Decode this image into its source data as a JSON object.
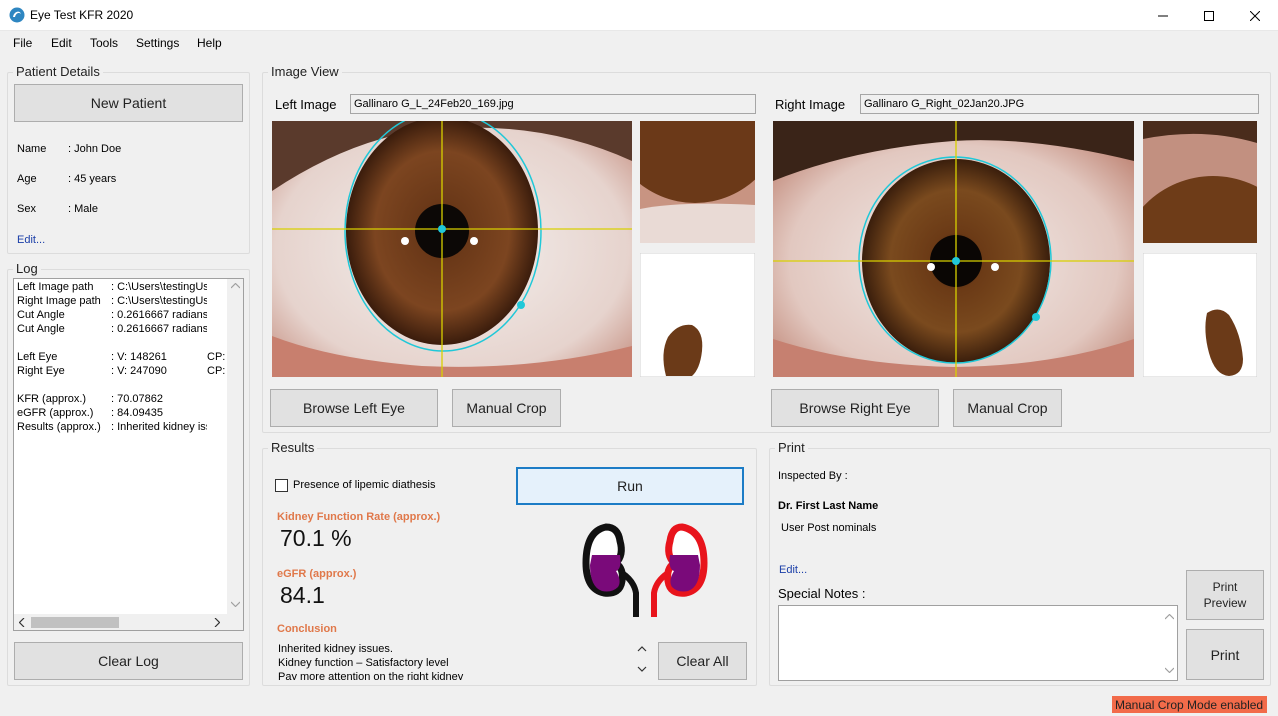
{
  "window": {
    "title": "Eye Test KFR 2020"
  },
  "menu": [
    "File",
    "Edit",
    "Tools",
    "Settings",
    "Help"
  ],
  "patient": {
    "group_label": "Patient Details",
    "new_patient_label": "New Patient",
    "fields": [
      {
        "key": "Name",
        "value": ": John Doe"
      },
      {
        "key": "Age",
        "value": ": 45 years"
      },
      {
        "key": "Sex",
        "value": ": Male"
      }
    ],
    "edit_link": "Edit..."
  },
  "log": {
    "group_label": "Log",
    "rows": [
      {
        "k": "Left Image path",
        "v": ": C:\\Users\\testingUser\\",
        "x": ""
      },
      {
        "k": "Right Image path",
        "v": ": C:\\Users\\testingUser\\",
        "x": ""
      },
      {
        "k": "Cut Angle",
        "v": ": 0.2616667 radians",
        "x": ""
      },
      {
        "k": "Cut Angle",
        "v": ": 0.2616667 radians",
        "x": ""
      },
      {
        "k": "",
        "v": "",
        "x": ""
      },
      {
        "k": "Left Eye",
        "v": ": V: 148261",
        "x": "CP:"
      },
      {
        "k": "Right Eye",
        "v": ": V: 247090",
        "x": "CP:"
      },
      {
        "k": "",
        "v": "",
        "x": ""
      },
      {
        "k": "KFR (approx.)",
        "v": ": 70.07862",
        "x": ""
      },
      {
        "k": "eGFR (approx.)",
        "v": ": 84.09435",
        "x": ""
      },
      {
        "k": "Results (approx.)",
        "v": ": Inherited kidney issu",
        "x": ""
      }
    ],
    "clear_label": "Clear Log"
  },
  "image_view": {
    "group_label": "Image View",
    "left": {
      "label": "Left Image",
      "filename": "Gallinaro G_L_24Feb20_169.jpg",
      "browse_label": "Browse Left Eye",
      "crop_label": "Manual Crop"
    },
    "right": {
      "label": "Right Image",
      "filename": "Gallinaro G_Right_02Jan20.JPG",
      "browse_label": "Browse Right Eye",
      "crop_label": "Manual Crop"
    }
  },
  "results": {
    "group_label": "Results",
    "lipemic_label": "Presence of lipemic diathesis",
    "lipemic_checked": false,
    "run_label": "Run",
    "kfr_label": "Kidney Function Rate (approx.)",
    "kfr_value": "70.1 %",
    "egfr_label": "eGFR (approx.)",
    "egfr_value": "84.1",
    "conclusion_label": "Conclusion",
    "conclusion_lines": [
      "Inherited kidney issues.",
      "Kidney function – Satisfactory level",
      "Pay more attention on the right kidney"
    ],
    "clear_all_label": "Clear All",
    "kidney_colors": {
      "left_outline": "#111111",
      "right_outline": "#e8141c",
      "fill": "#7a0a7a"
    }
  },
  "print": {
    "group_label": "Print",
    "inspected_label": "Inspected By :",
    "doctor_name": "Dr. First Last Name",
    "post_nominals": "User Post nominals",
    "edit_link": "Edit...",
    "notes_label": "Special Notes :",
    "notes_value": "",
    "preview_line1": "Print",
    "preview_line2": "Preview",
    "print_label": "Print"
  },
  "status": {
    "badge": "Manual Crop Mode enabled",
    "color": "#f26b4a"
  }
}
